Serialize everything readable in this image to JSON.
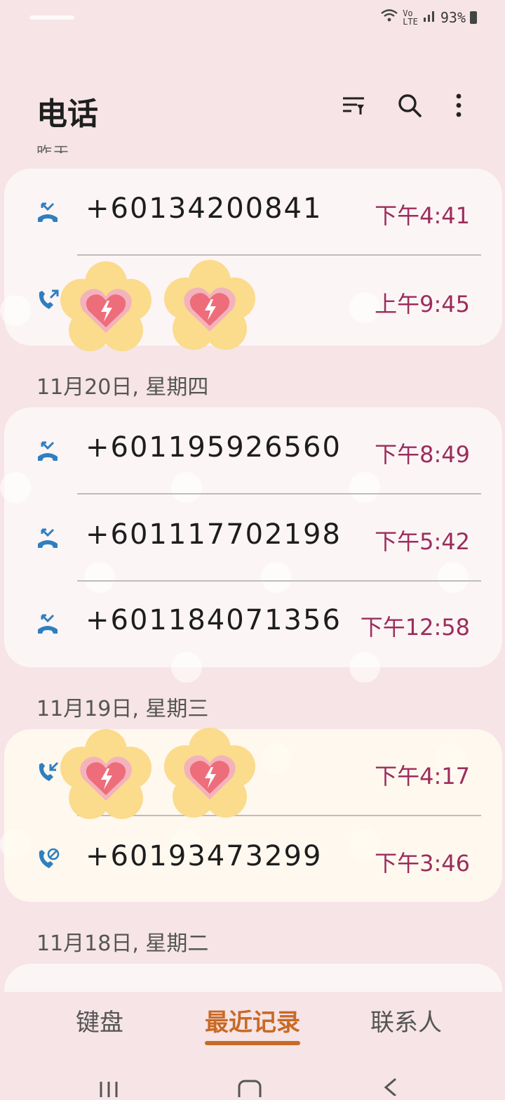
{
  "status": {
    "battery": "93%"
  },
  "header": {
    "title": "电话",
    "icons": [
      "filter-icon",
      "search-icon",
      "more-options-icon"
    ]
  },
  "cut_label": "昨天",
  "groups": [
    {
      "date": "",
      "rows": [
        {
          "number": "+60134200841",
          "time": "下午4:41",
          "type": "missed"
        },
        {
          "number": "",
          "time": "上午9:45",
          "type": "outgoing",
          "covered": true
        }
      ]
    },
    {
      "date": "11月20日, 星期四",
      "rows": [
        {
          "number": "+601195926560",
          "time": "下午8:49",
          "type": "missed"
        },
        {
          "number": "+601117702198",
          "time": "下午5:42",
          "type": "missed"
        },
        {
          "number": "+601184071356",
          "time": "下午12:58",
          "type": "missed"
        }
      ]
    },
    {
      "date": "11月19日, 星期三",
      "rows": [
        {
          "number": "",
          "time": "下午4:17",
          "type": "incoming",
          "covered": true
        },
        {
          "number": "+60193473299",
          "time": "下午3:46",
          "type": "rejected"
        }
      ]
    },
    {
      "date": "11月18日, 星期二",
      "rows": []
    }
  ],
  "bottom_tabs": [
    {
      "label": "键盘",
      "active": false
    },
    {
      "label": "最近记录",
      "active": true
    },
    {
      "label": "联系人",
      "active": false
    }
  ],
  "colors": {
    "accent": "#c86a25",
    "time": "#9b2d5c",
    "callIcon": "#2f7fc0",
    "missedIcon": "#2f7fc0"
  }
}
